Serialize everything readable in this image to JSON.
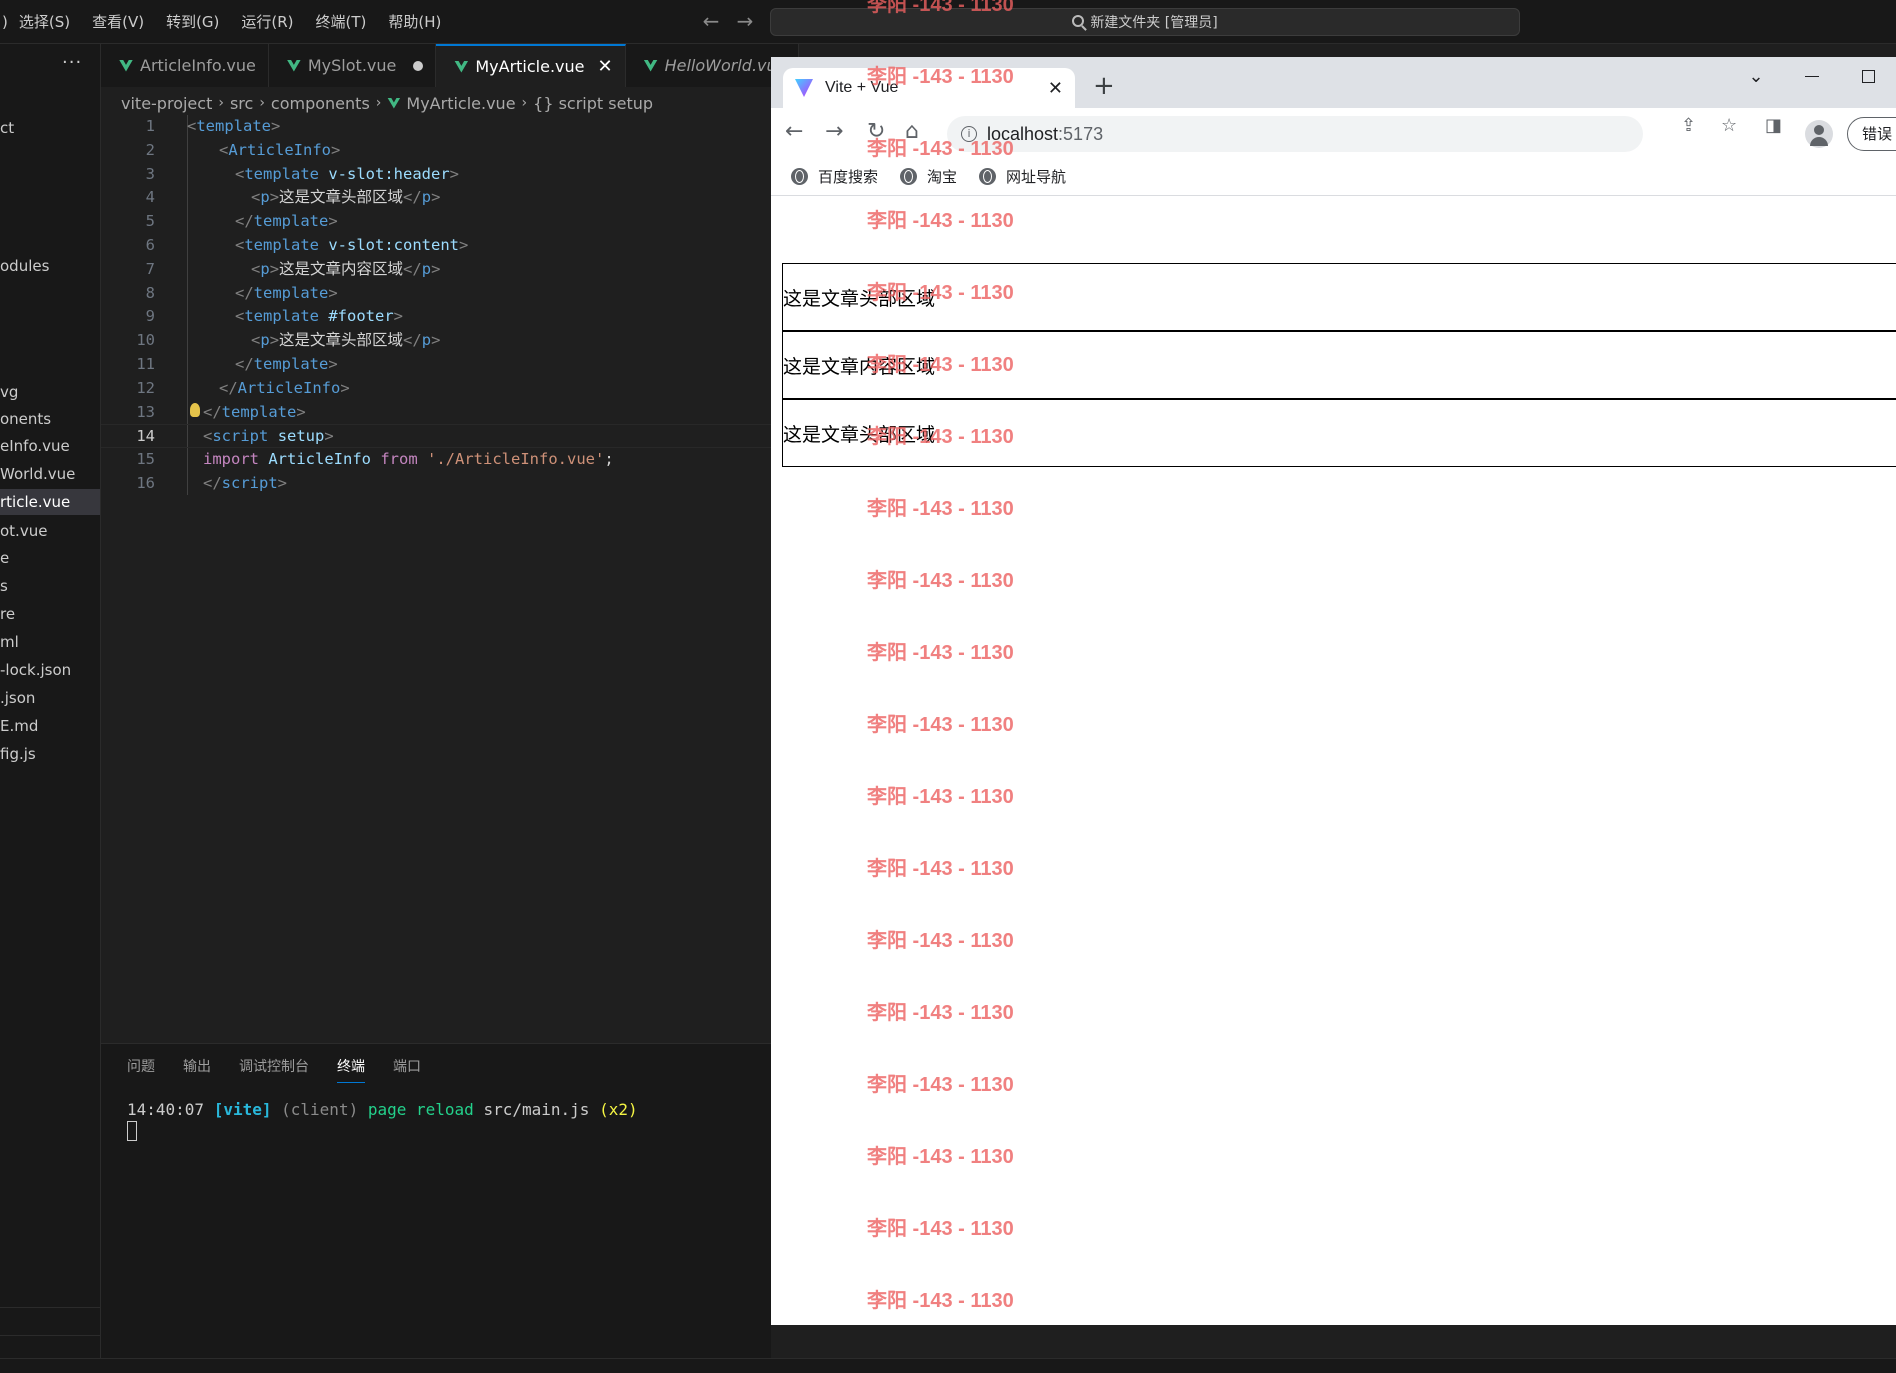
{
  "vscode": {
    "menu": [
      "选择(S)",
      "查看(V)",
      "转到(G)",
      "运行(R)",
      "终端(T)",
      "帮助(H)"
    ],
    "command_center": "新建文件夹 [管理员]",
    "explorer": {
      "more_label": "···",
      "items": [
        "ct",
        "odules",
        "vg",
        "onents",
        "eInfo.vue",
        "World.vue",
        "rticle.vue",
        "ot.vue",
        "e",
        "s",
        "re",
        "ml",
        "-lock.json",
        ".json",
        "E.md",
        "fig.js"
      ],
      "selected_index": 6
    },
    "tabs": [
      {
        "label": "ArticleInfo.vue",
        "state": "normal"
      },
      {
        "label": "MySlot.vue",
        "state": "modified"
      },
      {
        "label": "MyArticle.vue",
        "state": "active"
      },
      {
        "label": "HelloWorld.vue",
        "state": "preview"
      }
    ],
    "breadcrumb": {
      "parts": [
        "vite-project",
        "src",
        "components",
        "MyArticle.vue"
      ],
      "symbol": "{} script setup"
    },
    "code": {
      "current_line": 14,
      "lines": [
        {
          "n": "1",
          "indent": 0,
          "tokens": [
            [
              "br",
              "<"
            ],
            [
              "tag",
              "template"
            ],
            [
              "br",
              ">"
            ]
          ]
        },
        {
          "n": "2",
          "indent": 4,
          "tokens": [
            [
              "br",
              "<"
            ],
            [
              "tag",
              "ArticleInfo"
            ],
            [
              "br",
              ">"
            ]
          ]
        },
        {
          "n": "3",
          "indent": 6,
          "tokens": [
            [
              "br",
              "<"
            ],
            [
              "tag",
              "template"
            ],
            [
              "text",
              " "
            ],
            [
              "attr",
              "v-slot:header"
            ],
            [
              "br",
              ">"
            ]
          ]
        },
        {
          "n": "4",
          "indent": 8,
          "tokens": [
            [
              "br",
              "<"
            ],
            [
              "tag",
              "p"
            ],
            [
              "br",
              ">"
            ],
            [
              "text",
              "这是文章头部区域"
            ],
            [
              "br",
              "</"
            ],
            [
              "tag",
              "p"
            ],
            [
              "br",
              ">"
            ]
          ]
        },
        {
          "n": "5",
          "indent": 6,
          "tokens": [
            [
              "br",
              "</"
            ],
            [
              "tag",
              "template"
            ],
            [
              "br",
              ">"
            ]
          ]
        },
        {
          "n": "6",
          "indent": 6,
          "tokens": [
            [
              "br",
              "<"
            ],
            [
              "tag",
              "template"
            ],
            [
              "text",
              " "
            ],
            [
              "attr",
              "v-slot:content"
            ],
            [
              "br",
              ">"
            ]
          ]
        },
        {
          "n": "7",
          "indent": 8,
          "tokens": [
            [
              "br",
              "<"
            ],
            [
              "tag",
              "p"
            ],
            [
              "br",
              ">"
            ],
            [
              "text",
              "这是文章内容区域"
            ],
            [
              "br",
              "</"
            ],
            [
              "tag",
              "p"
            ],
            [
              "br",
              ">"
            ]
          ]
        },
        {
          "n": "8",
          "indent": 6,
          "tokens": [
            [
              "br",
              "</"
            ],
            [
              "tag",
              "template"
            ],
            [
              "br",
              ">"
            ]
          ]
        },
        {
          "n": "9",
          "indent": 6,
          "tokens": [
            [
              "br",
              "<"
            ],
            [
              "tag",
              "template"
            ],
            [
              "text",
              " "
            ],
            [
              "attr",
              "#footer"
            ],
            [
              "br",
              ">"
            ]
          ]
        },
        {
          "n": "10",
          "indent": 8,
          "tokens": [
            [
              "br",
              "<"
            ],
            [
              "tag",
              "p"
            ],
            [
              "br",
              ">"
            ],
            [
              "text",
              "这是文章头部区域"
            ],
            [
              "br",
              "</"
            ],
            [
              "tag",
              "p"
            ],
            [
              "br",
              ">"
            ]
          ]
        },
        {
          "n": "11",
          "indent": 6,
          "tokens": [
            [
              "br",
              "</"
            ],
            [
              "tag",
              "template"
            ],
            [
              "br",
              ">"
            ]
          ]
        },
        {
          "n": "12",
          "indent": 4,
          "tokens": [
            [
              "br",
              "</"
            ],
            [
              "tag",
              "ArticleInfo"
            ],
            [
              "br",
              ">"
            ]
          ]
        },
        {
          "n": "13",
          "indent": 2,
          "tokens": [
            [
              "br",
              "</"
            ],
            [
              "tag",
              "template"
            ],
            [
              "br",
              ">"
            ]
          ]
        },
        {
          "n": "14",
          "indent": 2,
          "tokens": [
            [
              "br",
              "<"
            ],
            [
              "tag",
              "script"
            ],
            [
              "text",
              " "
            ],
            [
              "attr",
              "setup"
            ],
            [
              "br",
              ">"
            ]
          ]
        },
        {
          "n": "15",
          "indent": 2,
          "tokens": [
            [
              "kw",
              "import"
            ],
            [
              "text",
              " "
            ],
            [
              "id",
              "ArticleInfo"
            ],
            [
              "text",
              " "
            ],
            [
              "kw",
              "from"
            ],
            [
              "text",
              " "
            ],
            [
              "str",
              "'./ArticleInfo.vue'"
            ],
            [
              "text",
              ";"
            ]
          ]
        },
        {
          "n": "16",
          "indent": 2,
          "tokens": [
            [
              "br",
              "</"
            ],
            [
              "tag",
              "script"
            ],
            [
              "br",
              ">"
            ]
          ]
        }
      ]
    },
    "panel": {
      "tabs": [
        "问题",
        "输出",
        "调试控制台",
        "终端",
        "端口"
      ],
      "active_tab": "终端",
      "terminal": {
        "time": "14:40:07",
        "tag": "[vite]",
        "client": "(client)",
        "action": "page reload",
        "file": "src/main.js",
        "count": "(x2)"
      }
    }
  },
  "browser": {
    "tab_title": "Vite + Vue",
    "url_host": "localhost",
    "url_port": ":5173",
    "error_button": "错误",
    "bookmarks": [
      "百度搜索",
      "淘宝",
      "网址导航"
    ],
    "articles": [
      "这是文章头部区域",
      "这是文章内容区域",
      "这是文章头部区域"
    ]
  },
  "watermark": {
    "text": "李阳 -143 - 1130",
    "count": 19
  }
}
